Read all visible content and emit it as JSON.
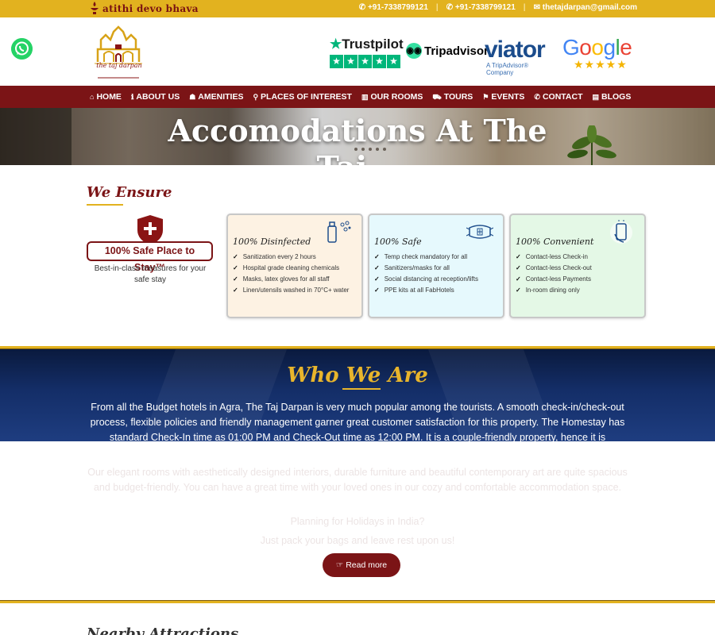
{
  "topbar": {
    "brand": "atithi devo bhava",
    "phone1": "+91-7338799121",
    "phone2": "+91-7338799121",
    "email": "thetajdarpan@gmail.com"
  },
  "header": {
    "logo_text": "the taj darpan",
    "badges": {
      "trustpilot": "Trustpilot",
      "tripadvisor": "Tripadvisor",
      "viator": "viator",
      "viator_sub": "A TripAdvisor® Company",
      "google": "Google"
    }
  },
  "nav": {
    "items": [
      {
        "icon": "⌂",
        "label": "HOME"
      },
      {
        "icon": "ℹ",
        "label": "ABOUT US"
      },
      {
        "icon": "☗",
        "label": "AMENITIES"
      },
      {
        "icon": "⚲",
        "label": "PLACES OF INTEREST"
      },
      {
        "icon": "▥",
        "label": "OUR ROOMS"
      },
      {
        "icon": "⛟",
        "label": "TOURS"
      },
      {
        "icon": "⚑",
        "label": "EVENTS"
      },
      {
        "icon": "✆",
        "label": "CONTACT"
      },
      {
        "icon": "▤",
        "label": "BLOGS"
      }
    ]
  },
  "hero": {
    "title_line1": "Accomodations At The",
    "title_line2": "Taj..."
  },
  "ensure": {
    "title": "We Ensure",
    "badge": "100% Safe Place to Stay™",
    "desc": "Best-in-class measures for your safe stay",
    "cards": [
      {
        "title": "100% Disinfected",
        "items": [
          "Sanitization every 2 hours",
          "Hospital grade cleaning chemicals",
          "Masks, latex gloves for all staff",
          "Linen/utensils washed in 70°C+ water"
        ]
      },
      {
        "title": "100% Safe",
        "items": [
          "Temp check mandatory for all",
          "Sanitizers/masks for all",
          "Social distancing at reception/lifts",
          "PPE kits at all FabHotels"
        ]
      },
      {
        "title": "100% Convenient",
        "items": [
          "Contact-less Check-in",
          "Contact-less Check-out",
          "Contact-less Payments",
          "In-room dining only"
        ]
      }
    ]
  },
  "who": {
    "title": "Who We Are",
    "p1": "From all the Budget hotels in Agra, The Taj Darpan is very much popular among the tourists. A smooth check-in/check-out process, flexible policies and friendly management garner great customer satisfaction for this property. The Homestay has standard Check-In time as 01:00 PM and Check-Out time as 12:00 PM. It is a couple-friendly property, hence it is absolutely safe for unmarried couples to stay here.",
    "p2": "Our elegant rooms with aesthetically designed interiors, durable furniture and beautiful contemporary art are quite spacious and budget-friendly. You can have a great time with your loved ones in our cozy and comfortable accommodation space.",
    "p3": "Planning for Holidays in India?",
    "p4": "Just pack your bags and leave rest upon us!",
    "button": "Read more"
  },
  "nearby": {
    "title": "Nearby Attractions"
  }
}
